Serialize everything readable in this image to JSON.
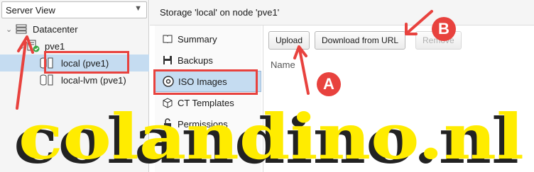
{
  "tree": {
    "view_selector": "Server View",
    "items": [
      {
        "label": "Datacenter"
      },
      {
        "label": "pve1"
      },
      {
        "label": "local (pve1)"
      },
      {
        "label": "local-lvm (pve1)"
      }
    ]
  },
  "header": {
    "title": "Storage 'local' on node 'pve1'"
  },
  "nav": {
    "items": [
      {
        "label": "Summary",
        "icon": "book-icon"
      },
      {
        "label": "Backups",
        "icon": "floppy-icon"
      },
      {
        "label": "ISO Images",
        "icon": "disc-icon"
      },
      {
        "label": "CT Templates",
        "icon": "cube-icon"
      },
      {
        "label": "Permissions",
        "icon": "unlock-icon"
      }
    ],
    "active": "ISO Images"
  },
  "toolbar": {
    "upload_label": "Upload",
    "download_url_label": "Download from URL",
    "remove_label": "Remove"
  },
  "grid": {
    "col_name": "Name"
  },
  "annotations": {
    "a": "A",
    "b": "B"
  },
  "watermark": "colandino.nl",
  "colors": {
    "annotation_red": "#e8423e",
    "selection_blue": "#c5dcf1",
    "watermark_yellow": "#ffec00"
  }
}
